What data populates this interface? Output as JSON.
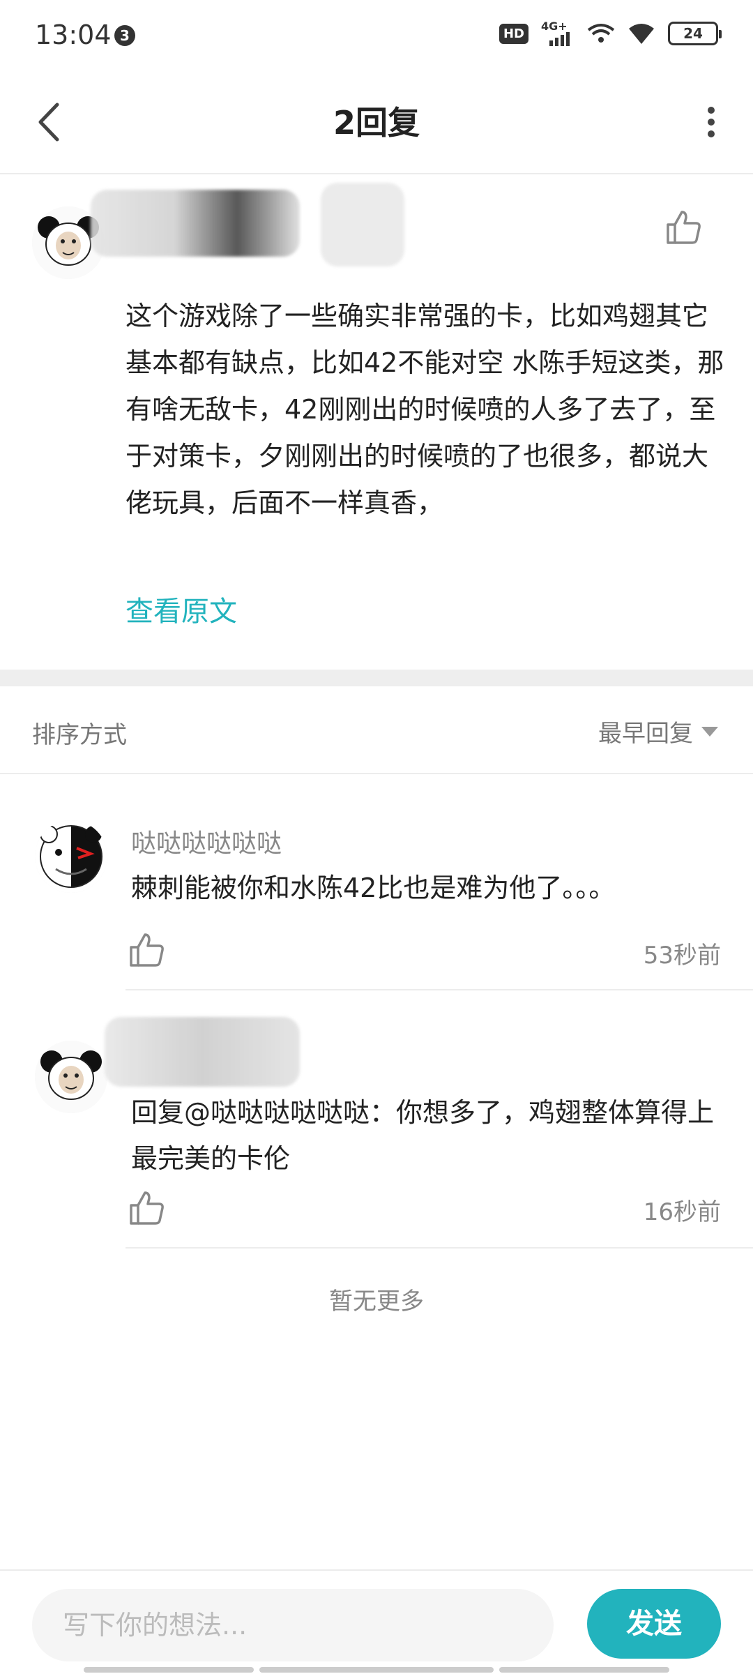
{
  "status_bar": {
    "time": "13:04",
    "notification_count": "3",
    "hd_label": "HD",
    "network_label": "4G+",
    "battery": "24"
  },
  "header": {
    "title": "2回复"
  },
  "main_comment": {
    "text": "这个游戏除了一些确实非常强的卡，比如鸡翅其它基本都有缺点，比如42不能对空 水陈手短这类，那有啥无敌卡，42刚刚出的时候喷的人多了去了，至于对策卡，夕刚刚出的时候喷的了也很多，都说大佬玩具，后面不一样真香，",
    "view_original": "查看原文"
  },
  "sort": {
    "label": "排序方式",
    "selected": "最早回复"
  },
  "replies": [
    {
      "username": "哒哒哒哒哒哒",
      "text": "棘刺能被你和水陈42比也是难为他了。。。",
      "time": "53秒前"
    },
    {
      "text": "回复@哒哒哒哒哒哒：你想多了，鸡翅整体算得上最完美的卡伦",
      "time": "16秒前"
    }
  ],
  "no_more": "暂无更多",
  "composer": {
    "placeholder": "写下你的想法...",
    "send_label": "发送"
  },
  "colors": {
    "accent": "#22b3bd",
    "secondary_text": "#888888",
    "divider": "#ececec"
  }
}
